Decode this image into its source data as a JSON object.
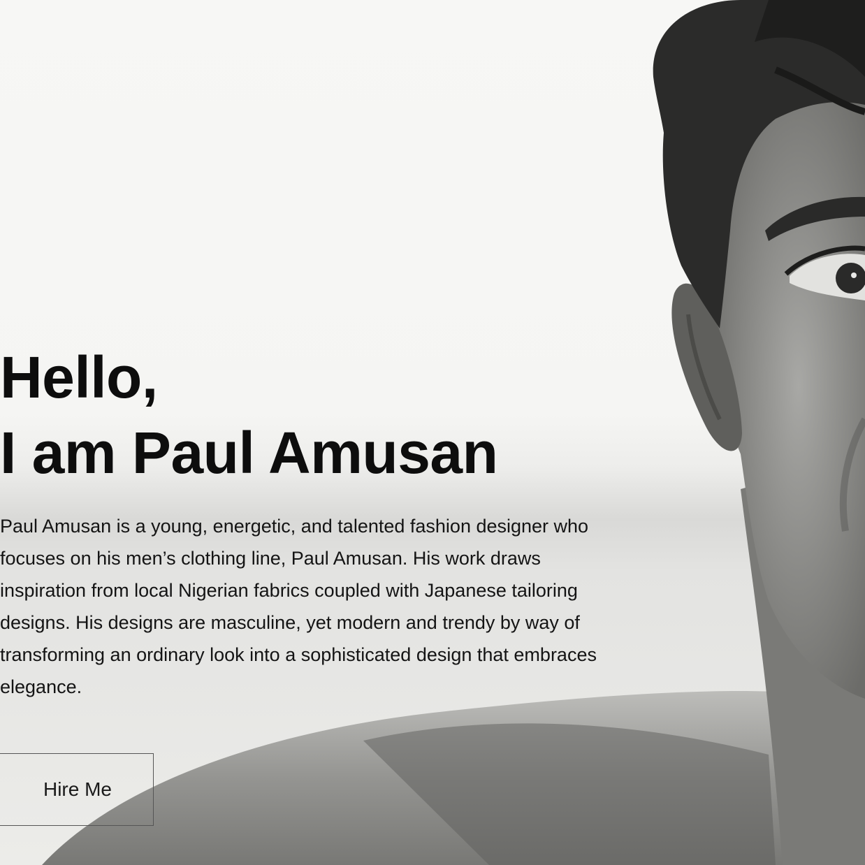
{
  "hero": {
    "headline_line1": "Hello,",
    "headline_line2": "I am Paul Amusan",
    "bio": "Paul Amusan is a young, energetic, and talented fashion designer who focuses on his men’s clothing line, Paul Amusan. His work draws inspiration from local Nigerian fabrics coupled with Japanese tailoring designs. His designs are masculine, yet modern and trendy by way of transforming an ordinary look into a sophisticated design that embraces elegance.",
    "cta_label": "Hire Me"
  },
  "colors": {
    "text": "#0d0d0d",
    "background": "#f5f5f3",
    "button_border": "#555555"
  }
}
